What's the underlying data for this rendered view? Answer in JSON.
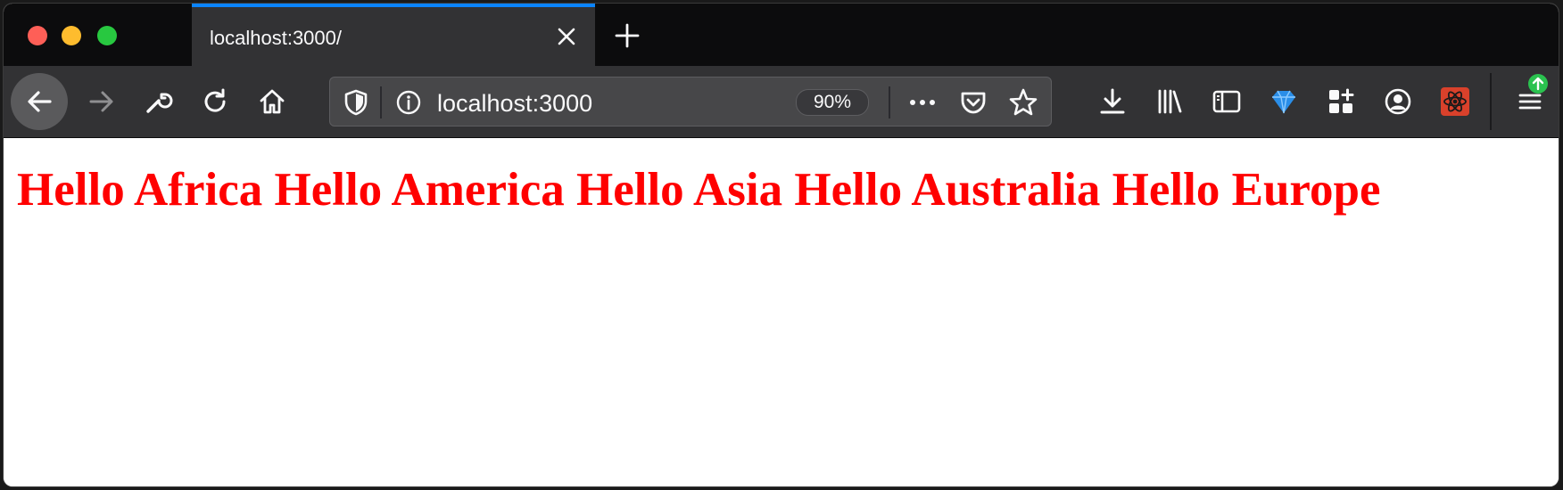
{
  "tab": {
    "title": "localhost:3000/"
  },
  "urlbar": {
    "url": "localhost:3000",
    "zoom": "90%"
  },
  "icons": {
    "back": "arrow-left-icon",
    "forward": "arrow-right-icon",
    "tools": "wrench-icon",
    "reload": "reload-icon",
    "home": "home-icon",
    "shield": "shield-icon",
    "info": "info-icon",
    "more": "ellipsis-icon",
    "pocket": "pocket-icon",
    "bookmark": "star-icon",
    "downloads": "download-icon",
    "library": "library-icon",
    "sidebar": "sidebar-icon",
    "extension_diamond": "diamond-icon",
    "extension_grid": "extensions-grid-icon",
    "account": "account-icon",
    "extension_red": "react-devtools-icon",
    "menu": "hamburger-menu-icon",
    "update": "update-badge-icon"
  },
  "colors": {
    "heading": "#ff0000",
    "tab_accent": "#0a84ff",
    "update_badge": "#2ac24f"
  },
  "page": {
    "heading": "Hello Africa Hello America Hello Asia Hello Australia Hello Europe"
  }
}
